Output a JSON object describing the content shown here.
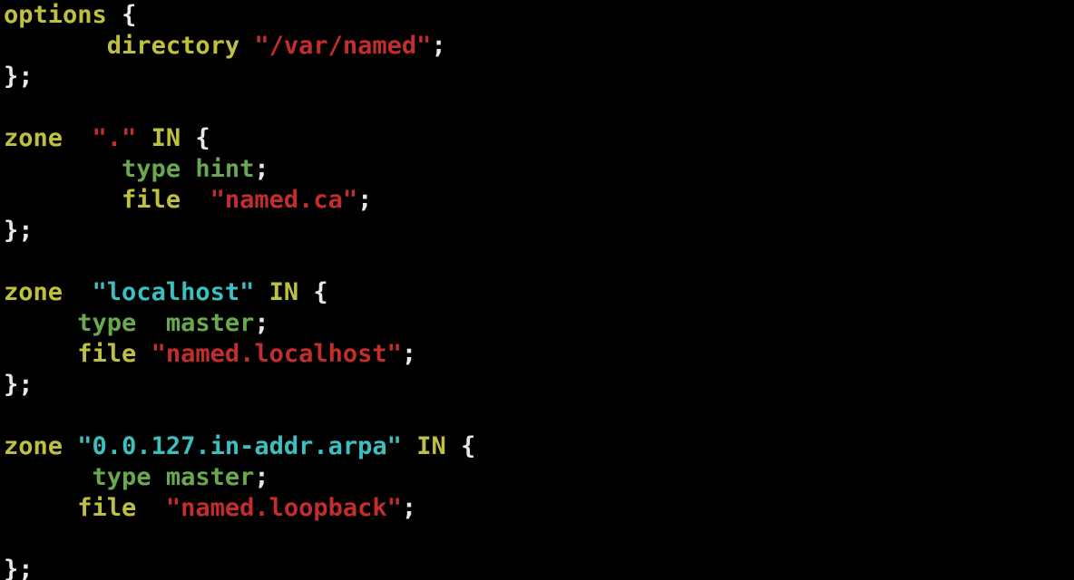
{
  "t": {
    "options": "options",
    "directory": "directory",
    "zone": "zone",
    "IN": "IN",
    "type": "type",
    "file": "file",
    "hint": "hint",
    "master": "master",
    "lb": "{",
    "rb": "}",
    "semi": ";",
    "rbsemi": "};"
  },
  "s": {
    "varnamed": "\"/var/named\"",
    "dot": "\".\"",
    "namedca": "\"named.ca\"",
    "localhost": "\"localhost\"",
    "namedlocalhost": "\"named.localhost\"",
    "ptr": "\"0.0.127.in-addr.arpa\"",
    "namedloopback": "\"named.loopback\""
  }
}
